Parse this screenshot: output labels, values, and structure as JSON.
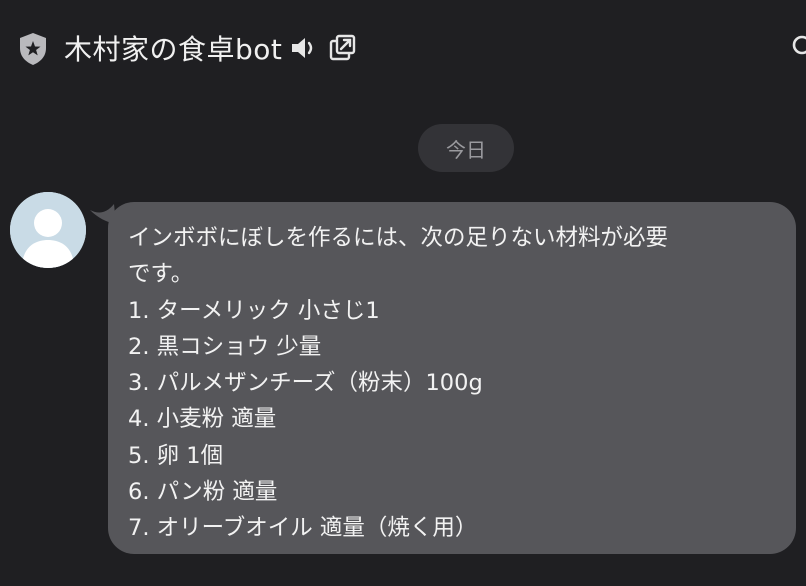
{
  "header": {
    "title": "木村家の食卓bot",
    "icons": [
      "shield-star-icon",
      "speaker-icon",
      "external-link-icon",
      "search-icon"
    ]
  },
  "date_divider": {
    "label": "今日"
  },
  "message": {
    "avatar_icon": "person-icon",
    "lines": [
      "インボボにぼしを作るには、次の足りない材料が必要",
      "です。",
      "1. ターメリック 小さじ1",
      "2. 黒コショウ 少量",
      "3. パルメザンチーズ（粉末）100g",
      "4. 小麦粉 適量",
      "5. 卵 1個",
      "6. パン粉 適量",
      "7. オリーブオイル 適量（焼く用）"
    ]
  },
  "colors": {
    "background": "#1f1f22",
    "bubble": "#56565a",
    "pill": "#333337",
    "avatar_bg": "#c9dbe6"
  }
}
